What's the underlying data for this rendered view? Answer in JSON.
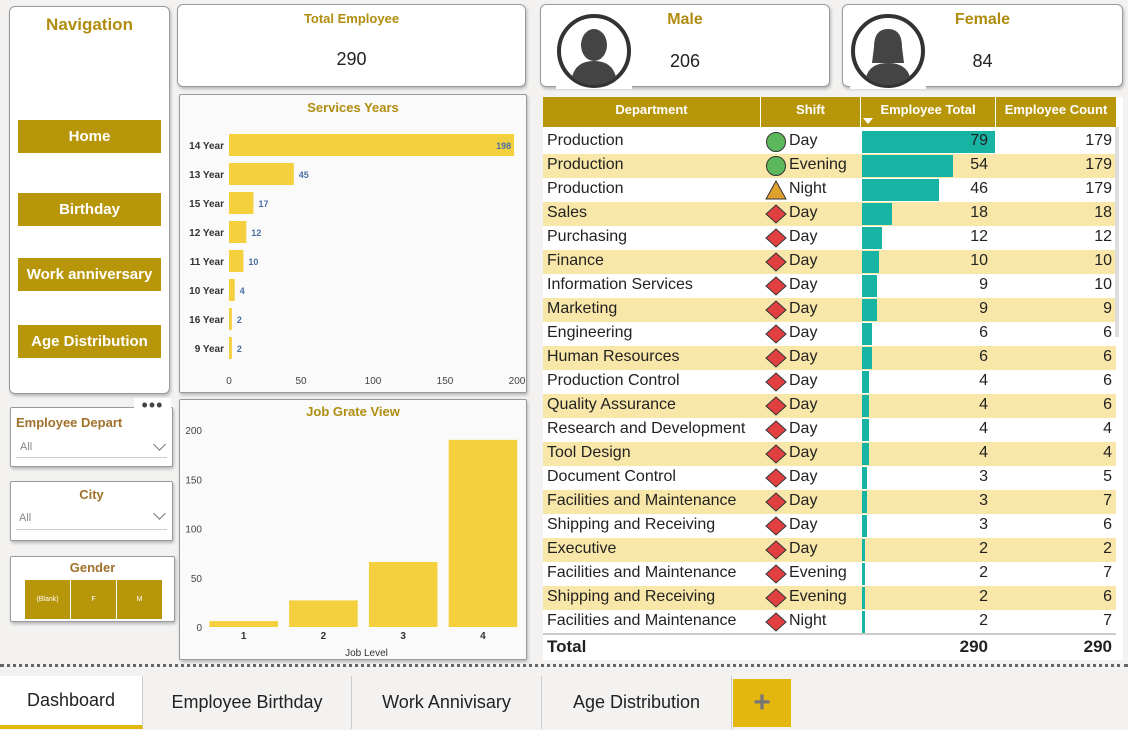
{
  "navigation": {
    "title": "Navigation",
    "buttons": [
      "Home",
      "Birthday",
      "Work anniversary",
      "Age Distribution"
    ]
  },
  "kpis": {
    "total": {
      "title": "Total Employee",
      "value": "290"
    },
    "male": {
      "title": "Male",
      "value": "206",
      "icon": "male-avatar-icon"
    },
    "female": {
      "title": "Female",
      "value": "84",
      "icon": "female-avatar-icon"
    }
  },
  "slicers": {
    "department": {
      "title": "Employee Depart",
      "value": "All"
    },
    "city": {
      "title": "City",
      "value": "All"
    },
    "gender": {
      "title": "Gender",
      "options": [
        "(Blank)",
        "F",
        "M"
      ]
    }
  },
  "services_chart": {
    "chart_data": {
      "type": "bar",
      "orientation": "horizontal",
      "title": "Services Years",
      "categories": [
        "14 Year",
        "13 Year",
        "15 Year",
        "12 Year",
        "11 Year",
        "10 Year",
        "16 Year",
        "9 Year"
      ],
      "values": [
        198,
        45,
        17,
        12,
        10,
        4,
        2,
        2
      ],
      "xticks": [
        "0",
        "50",
        "100",
        "150",
        "200"
      ],
      "xlim": [
        0,
        200
      ],
      "color": "#f4d03f"
    }
  },
  "job_chart": {
    "chart_data": {
      "type": "bar",
      "title": "Job Grate View",
      "xlabel": "Job Level",
      "categories": [
        "1",
        "2",
        "3",
        "4"
      ],
      "values": [
        6,
        27,
        66,
        190
      ],
      "yticks": [
        "0",
        "50",
        "100",
        "150",
        "200"
      ],
      "ylim": [
        0,
        200
      ],
      "color": "#f4d03f"
    }
  },
  "table": {
    "headers": [
      "Department",
      "Shift",
      "Employee Total",
      "Employee Count"
    ],
    "bar_max": 79,
    "bar_color": "#17b3a3",
    "rows": [
      {
        "dept": "Production",
        "shift": "Day",
        "status": "green",
        "total": "79",
        "count": "179"
      },
      {
        "dept": "Production",
        "shift": "Evening",
        "status": "green",
        "total": "54",
        "count": "179"
      },
      {
        "dept": "Production",
        "shift": "Night",
        "status": "orange",
        "total": "46",
        "count": "179"
      },
      {
        "dept": "Sales",
        "shift": "Day",
        "status": "red",
        "total": "18",
        "count": "18"
      },
      {
        "dept": "Purchasing",
        "shift": "Day",
        "status": "red",
        "total": "12",
        "count": "12"
      },
      {
        "dept": "Finance",
        "shift": "Day",
        "status": "red",
        "total": "10",
        "count": "10"
      },
      {
        "dept": "Information Services",
        "shift": "Day",
        "status": "red",
        "total": "9",
        "count": "10"
      },
      {
        "dept": "Marketing",
        "shift": "Day",
        "status": "red",
        "total": "9",
        "count": "9"
      },
      {
        "dept": "Engineering",
        "shift": "Day",
        "status": "red",
        "total": "6",
        "count": "6"
      },
      {
        "dept": "Human Resources",
        "shift": "Day",
        "status": "red",
        "total": "6",
        "count": "6"
      },
      {
        "dept": "Production Control",
        "shift": "Day",
        "status": "red",
        "total": "4",
        "count": "6"
      },
      {
        "dept": "Quality Assurance",
        "shift": "Day",
        "status": "red",
        "total": "4",
        "count": "6"
      },
      {
        "dept": "Research and Development",
        "shift": "Day",
        "status": "red",
        "total": "4",
        "count": "4"
      },
      {
        "dept": "Tool Design",
        "shift": "Day",
        "status": "red",
        "total": "4",
        "count": "4"
      },
      {
        "dept": "Document Control",
        "shift": "Day",
        "status": "red",
        "total": "3",
        "count": "5"
      },
      {
        "dept": "Facilities and Maintenance",
        "shift": "Day",
        "status": "red",
        "total": "3",
        "count": "7"
      },
      {
        "dept": "Shipping and Receiving",
        "shift": "Day",
        "status": "red",
        "total": "3",
        "count": "6"
      },
      {
        "dept": "Executive",
        "shift": "Day",
        "status": "red",
        "total": "2",
        "count": "2"
      },
      {
        "dept": "Facilities and Maintenance",
        "shift": "Evening",
        "status": "red",
        "total": "2",
        "count": "7"
      },
      {
        "dept": "Shipping and Receiving",
        "shift": "Evening",
        "status": "red",
        "total": "2",
        "count": "6"
      },
      {
        "dept": "Facilities and Maintenance",
        "shift": "Night",
        "status": "red",
        "total": "2",
        "count": "7"
      }
    ],
    "total": {
      "label": "Total",
      "total": "290",
      "count": "290"
    }
  },
  "tabs": {
    "items": [
      "Dashboard",
      "Employee Birthday",
      "Work Annivisary",
      "Age Distribution"
    ],
    "active": "Dashboard",
    "add_label": "+"
  },
  "colors": {
    "accent": "#b8960a",
    "bar": "#f4d03f",
    "teal": "#17b3a3",
    "row_alt": "#f8e7a8",
    "status_green": "#5cb85c",
    "status_orange": "#e0a030",
    "status_red": "#e04040"
  }
}
